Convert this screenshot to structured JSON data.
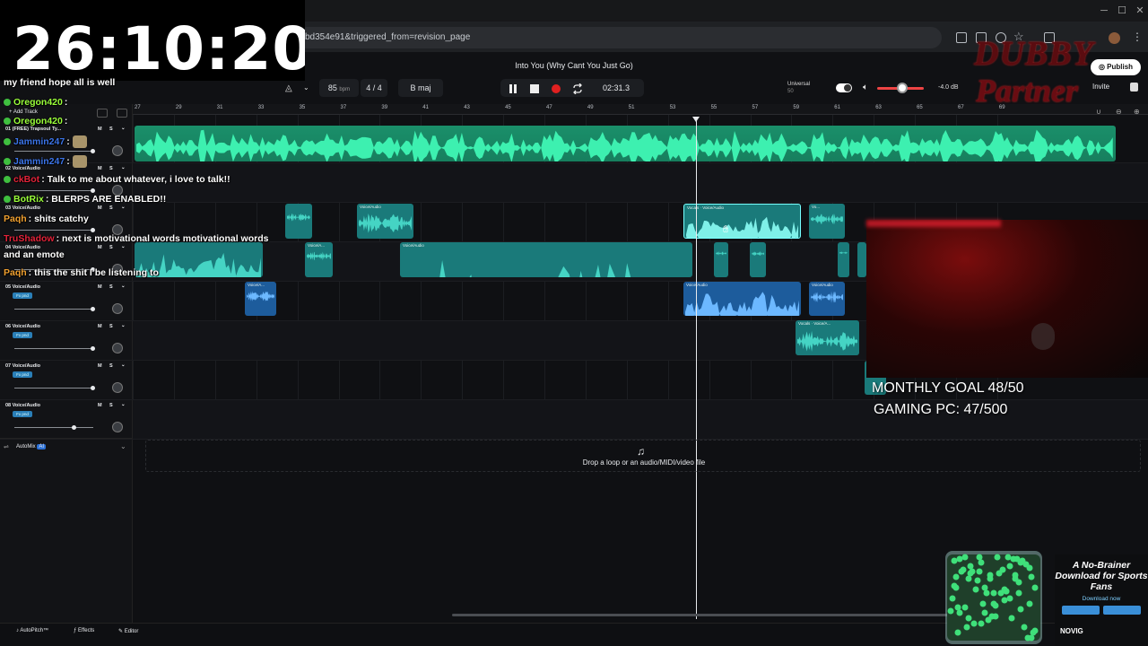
{
  "overlay": {
    "timer": "26:10:20",
    "goal_monthly": "MONTHLY GOAL 48/50",
    "goal_pc": "GAMING PC: 47/500",
    "logo_line1": "DUBBY",
    "logo_line2": "Partner"
  },
  "browser": {
    "url_fragment": "bd354e91&triggered_from=revision_page"
  },
  "app": {
    "song_title": "Into You (Why Cant You Just Go)",
    "bpm_value": "85",
    "bpm_unit": "bpm",
    "time_signature": "4 / 4",
    "key": "B maj",
    "time_readout": "02:31.3",
    "universal_label": "Universal",
    "universal_sub": "50",
    "volume_db": "-4.0 dB",
    "publish_label": "Publish",
    "invite_label": "Invite",
    "add_track_label": "Add Track",
    "automix_label": "AutoMix",
    "ai_badge": "AI",
    "drop_text": "Drop a loop or an audio/MIDI/video file",
    "bottom": {
      "autopitch": "AutoPitch™",
      "effects": "Effects",
      "editor": "Editor"
    }
  },
  "ruler": [
    "27",
    "29",
    "31",
    "33",
    "35",
    "37",
    "39",
    "41",
    "43",
    "45",
    "47",
    "49",
    "51",
    "53",
    "55",
    "57",
    "59",
    "61",
    "63",
    "65",
    "67",
    "69"
  ],
  "tracks": [
    {
      "num": "01",
      "name": "(FREE) Trapsoul Ty..."
    },
    {
      "num": "02",
      "name": "Voice/Audio"
    },
    {
      "num": "03",
      "name": "Voice/Audio"
    },
    {
      "num": "04",
      "name": "Voice/Audio"
    },
    {
      "num": "05",
      "name": "Voice/Audio",
      "fx": "Fx pnd"
    },
    {
      "num": "06",
      "name": "Voice/Audio",
      "fx": "Fx pnd"
    },
    {
      "num": "07",
      "name": "Voice/Audio",
      "fx": "Fx pnd"
    },
    {
      "num": "08",
      "name": "Voice/Audio",
      "fx": "Fx pnd"
    }
  ],
  "track_ms": {
    "m": "M",
    "s": "S"
  },
  "clips": {
    "voice_audio": "Voice/Audio",
    "voice_short": "Voice/A...",
    "vocals": "Vocals",
    "vo": "Vo..."
  },
  "chat": [
    {
      "name": "",
      "text": "my friend hope all is well",
      "color": "#ffffff"
    },
    {
      "name": "Oregon420",
      "text": ":",
      "color": "#9aff3a"
    },
    {
      "name": "Oregon420",
      "text": ":",
      "color": "#9aff3a"
    },
    {
      "name": "Jammin247",
      "text": ":",
      "color": "#3b74e8"
    },
    {
      "name": "Jammin247",
      "text": ":",
      "color": "#3b74e8"
    },
    {
      "name": "ckBot",
      "text": ": Talk to me about whatever, i love to talk!!",
      "color": "#e3233a"
    },
    {
      "name": "BotRix",
      "text": ": BLERPS ARE ENABLED!!",
      "color": "#9aff3a"
    },
    {
      "name": "Paqh",
      "text": ": shits catchy",
      "color": "#f0a030"
    },
    {
      "name": "TruShadow",
      "text": ": next is motivational words motivational words",
      "color": "#e3233a"
    },
    {
      "name": "",
      "text": "and an emote",
      "color": "#ffffff"
    },
    {
      "name": "Paqh",
      "text": ": this the shit I be listening to",
      "color": "#f0a030"
    }
  ],
  "ad": {
    "headline": "A No-Brainer Download for Sports Fans",
    "cta": "Download now",
    "brand": "NOVIG"
  },
  "colors": {
    "accent_green": "#1a8f6a",
    "clip_teal": "#1a7a7a",
    "clip_blue": "#1d5c9c",
    "record_red": "#e02020"
  }
}
